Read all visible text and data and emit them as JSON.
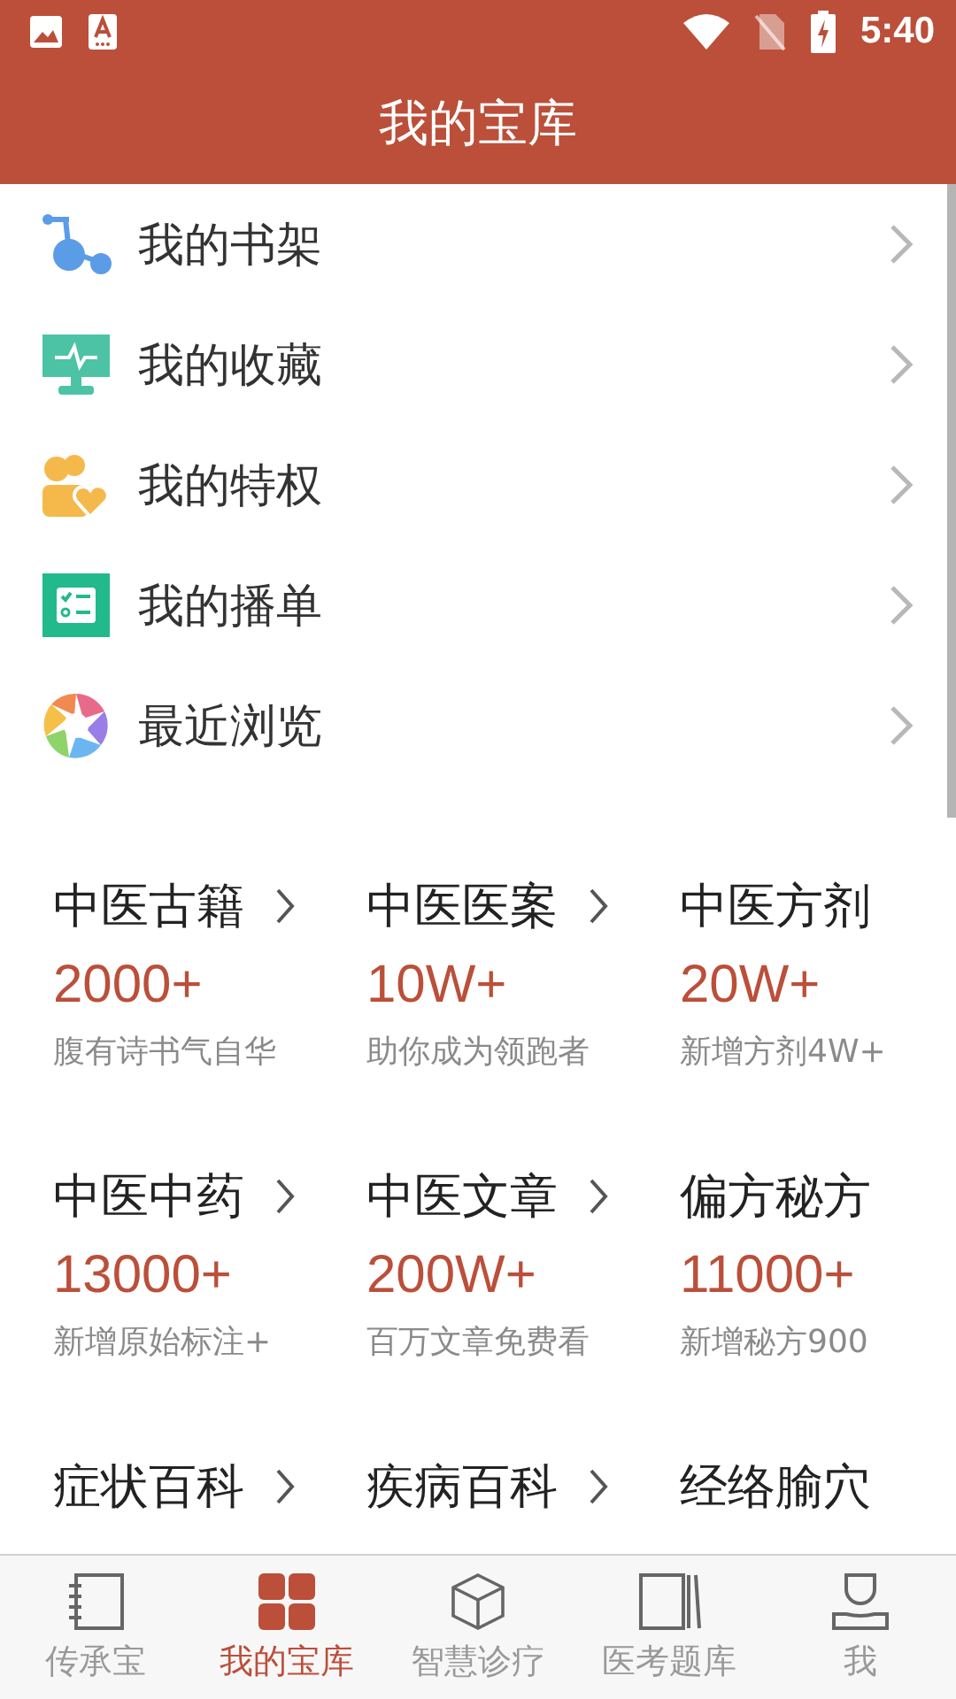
{
  "status_bar": {
    "time": "5:40"
  },
  "header": {
    "title": "我的宝库"
  },
  "menu": [
    {
      "label": "我的书架"
    },
    {
      "label": "我的收藏"
    },
    {
      "label": "我的特权"
    },
    {
      "label": "我的播单"
    },
    {
      "label": "最近浏览"
    }
  ],
  "categories": [
    {
      "title": "中医古籍",
      "has_arrow": true,
      "count": "2000+",
      "subtitle": "腹有诗书气自华"
    },
    {
      "title": "中医医案",
      "has_arrow": true,
      "count": "10W+",
      "subtitle": "助你成为领跑者"
    },
    {
      "title": "中医方剂",
      "has_arrow": false,
      "count": "20W+",
      "subtitle": "新增方剂4W+"
    },
    {
      "title": "中医中药",
      "has_arrow": true,
      "count": "13000+",
      "subtitle": "新增原始标注+"
    },
    {
      "title": "中医文章",
      "has_arrow": true,
      "count": "200W+",
      "subtitle": "百万文章免费看"
    },
    {
      "title": "偏方秘方",
      "has_arrow": false,
      "count": "11000+",
      "subtitle": "新增秘方900"
    },
    {
      "title": "症状百科",
      "has_arrow": true
    },
    {
      "title": "疾病百科",
      "has_arrow": true
    },
    {
      "title": "经络腧穴",
      "has_arrow": false
    }
  ],
  "tabs": [
    {
      "label": "传承宝",
      "selected": false
    },
    {
      "label": "我的宝库",
      "selected": true
    },
    {
      "label": "智慧诊疗",
      "selected": false
    },
    {
      "label": "医考题库",
      "selected": false
    },
    {
      "label": "我",
      "selected": false
    }
  ]
}
